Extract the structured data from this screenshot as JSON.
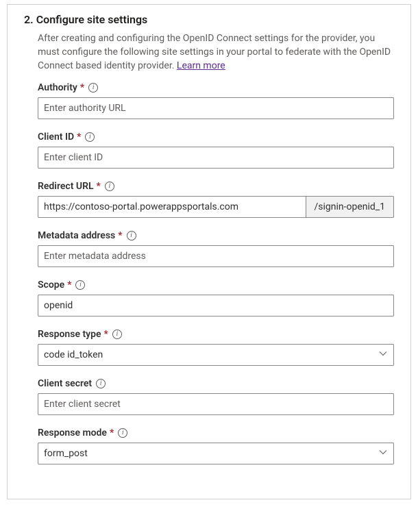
{
  "step": {
    "number": "2.",
    "title": "Configure site settings",
    "description": "After creating and configuring the OpenID Connect settings for the provider, you must configure the following site settings in your portal to federate with the OpenID Connect based identity provider. ",
    "learn_more": "Learn more"
  },
  "fields": {
    "authority": {
      "label": "Authority",
      "placeholder": "Enter authority URL",
      "value": ""
    },
    "client_id": {
      "label": "Client ID",
      "placeholder": "Enter client ID",
      "value": ""
    },
    "redirect_url": {
      "label": "Redirect URL",
      "value": "https://contoso-portal.powerappsportals.com",
      "suffix": "/signin-openid_1"
    },
    "metadata": {
      "label": "Metadata address",
      "placeholder": "Enter metadata address",
      "value": ""
    },
    "scope": {
      "label": "Scope",
      "value": "openid"
    },
    "response_type": {
      "label": "Response type",
      "value": "code id_token"
    },
    "client_secret": {
      "label": "Client secret",
      "placeholder": "Enter client secret",
      "value": ""
    },
    "response_mode": {
      "label": "Response mode",
      "value": "form_post"
    }
  },
  "marks": {
    "required": "*"
  }
}
